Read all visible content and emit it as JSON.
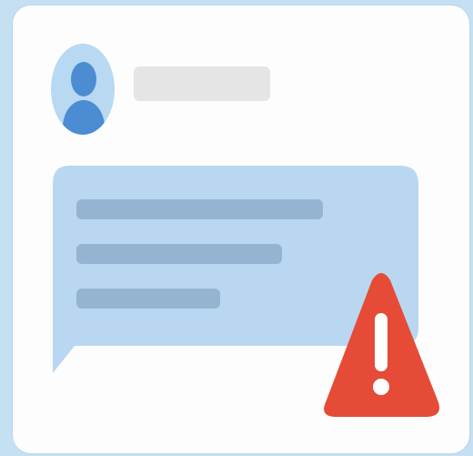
{
  "illustration": {
    "subject": "",
    "profile": {
      "avatar_icon": "user-silhouette-icon",
      "name_placeholder": ""
    },
    "message_bubble": {
      "text_lines": [
        "",
        "",
        ""
      ]
    },
    "warning": {
      "icon": "warning-triangle-icon",
      "symbol": "!"
    }
  },
  "colors": {
    "background": "#c5dff3",
    "card": "#fdfdfd",
    "avatar_ring": "#b9d8f1",
    "avatar_figure": "#4c8cd2",
    "name_placeholder": "#e5e5e5",
    "bubble": "#b9d7f1",
    "bubble_lines": "#94b4d2",
    "warning_red": "#e54b36",
    "warning_mark": "#ffffff"
  }
}
